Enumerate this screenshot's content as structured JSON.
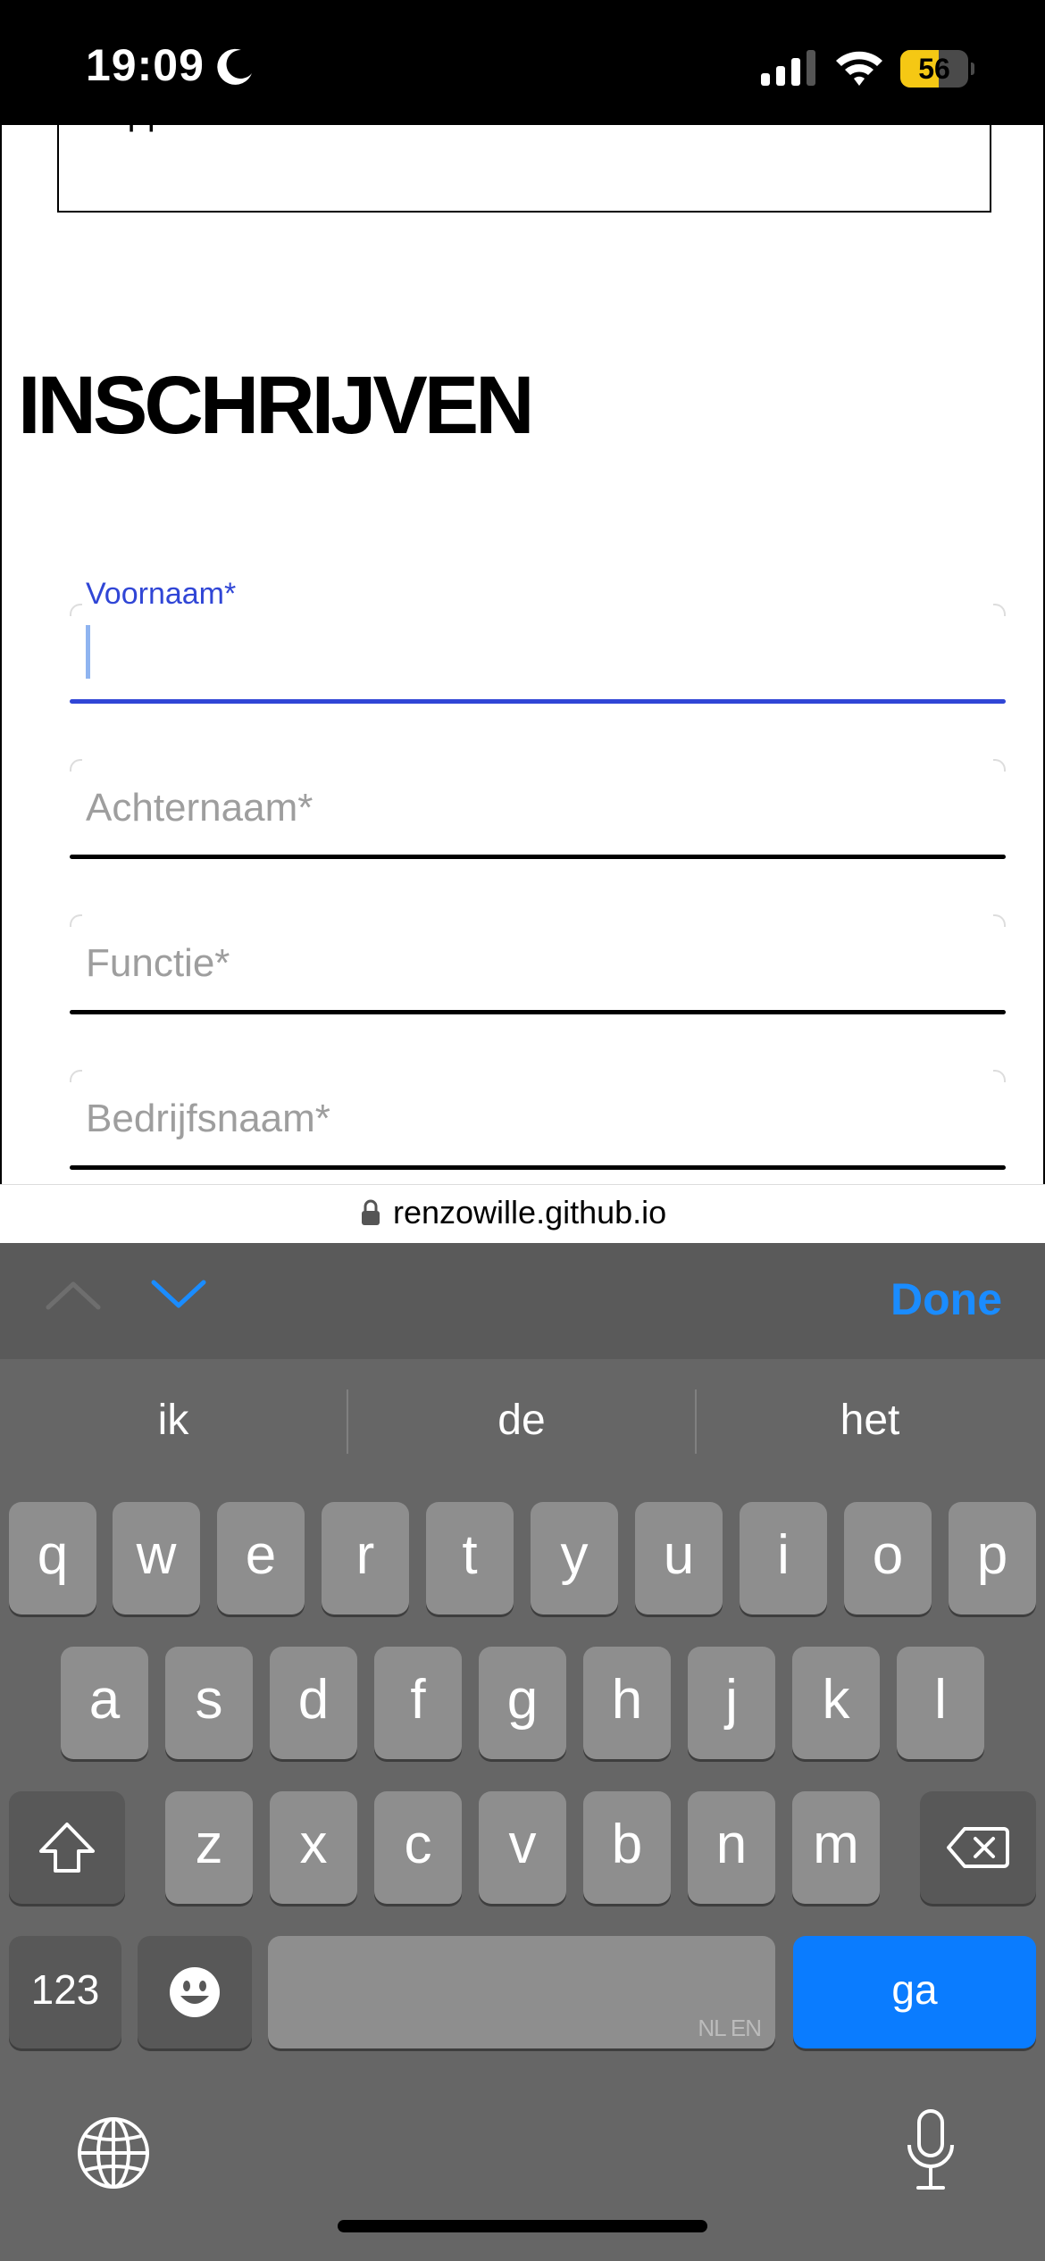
{
  "status_bar": {
    "time": "19:09",
    "battery_percent": "56",
    "battery_level": 0.56,
    "icons": [
      "moon-icon",
      "signal-icon",
      "wifi-icon",
      "battery-icon"
    ]
  },
  "page": {
    "previous_section_text": "App",
    "title": "INSCHRIJVEN",
    "fields": [
      {
        "label": "Voornaam*",
        "value": "",
        "active": true
      },
      {
        "placeholder": "Achternaam*"
      },
      {
        "placeholder": "Functie*"
      },
      {
        "placeholder": "Bedrijfsnaam*"
      }
    ]
  },
  "url_bar": {
    "domain": "renzowille.github.io"
  },
  "keyboard": {
    "done_label": "Done",
    "suggestions": [
      "ik",
      "de",
      "het"
    ],
    "row1": [
      "q",
      "w",
      "e",
      "r",
      "t",
      "y",
      "u",
      "i",
      "o",
      "p"
    ],
    "row2": [
      "a",
      "s",
      "d",
      "f",
      "g",
      "h",
      "j",
      "k",
      "l"
    ],
    "row3": [
      "z",
      "x",
      "c",
      "v",
      "b",
      "n",
      "m"
    ],
    "numbers_label": "123",
    "space_languages": "NL EN",
    "go_label": "ga",
    "colors": {
      "accent": "#0a7cff",
      "field_active": "#3046d6"
    }
  }
}
